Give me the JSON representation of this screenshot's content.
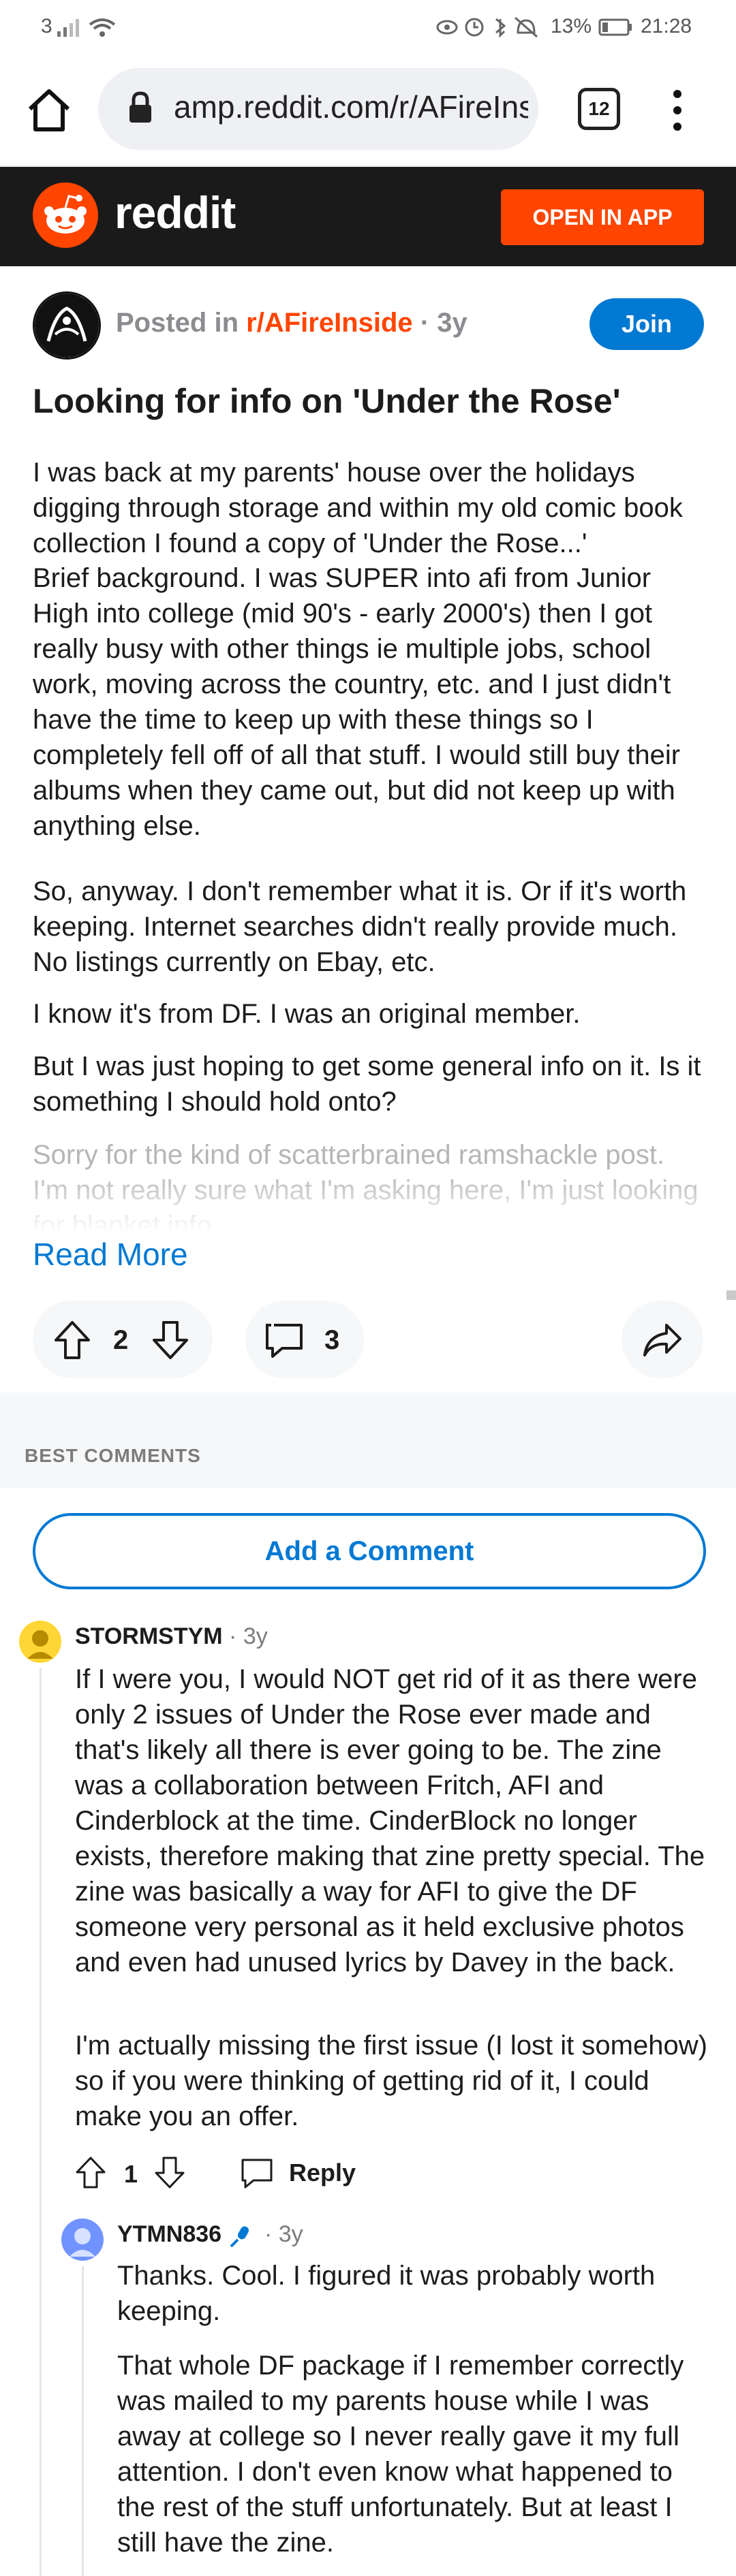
{
  "status_bar": {
    "signal_text": "3",
    "battery": "13%",
    "time": "21:28"
  },
  "browser": {
    "url": "amp.reddit.com/r/AFireInside",
    "tab_count": "12"
  },
  "reddit_header": {
    "logo_text": "reddit",
    "open_in_app": "OPEN IN APP"
  },
  "post": {
    "posted_in_prefix": "Posted in ",
    "subreddit": "r/AFireInside",
    "age": " · 3y",
    "join_label": "Join",
    "title": "Looking for info on 'Under the Rose'",
    "paragraphs": [
      "I was back at my parents' house over the holidays digging through storage and within my old comic book collection I found a copy of 'Under the Rose...'",
      "Brief background. I was SUPER into afi from Junior High into college (mid 90's - early 2000's) then I got really busy with other things ie multiple jobs, school work, moving across the country, etc. and I just didn't have the time to keep up with these things so I completely fell off of all that stuff. I would still buy their albums when they came out, but did not keep up with anything else.",
      "So, anyway. I don't remember what it is. Or if it's worth keeping. Internet searches didn't really provide much. No listings currently on Ebay, etc.",
      "I know it's from DF. I was an original member.",
      "But I was just hoping to get some general info on it. Is it something I should hold onto?"
    ],
    "faded_text": "Sorry for the kind of scatterbrained ramshackle post. I'm not really sure what I'm asking here, I'm just looking for blanket info.",
    "read_more": "Read More",
    "vote_count": "2",
    "comment_count": "3"
  },
  "comments_section": {
    "header": "BEST COMMENTS",
    "add_comment": "Add a Comment"
  },
  "comments": [
    {
      "username": "STORMSTYM",
      "age": " · 3y",
      "paragraphs": [
        "If I were you, I would NOT get rid of it as there were only 2 issues of Under the Rose ever made and that's likely all there is ever going to be. The zine was a collaboration between Fritch, AFI and Cinderblock at the time. CinderBlock no longer exists, therefore making that zine pretty special. The zine was basically a way for AFI to give the DF someone very personal as it held exclusive photos and even had unused lyrics by Davey in the back.",
        "I'm actually missing the first issue (I lost it somehow) so if you were thinking of getting rid of it, I could make you an offer."
      ],
      "vote_count": "1",
      "reply_label": "Reply"
    },
    {
      "username": "YTMN836",
      "age": " · 3y",
      "paragraphs": [
        "Thanks. Cool. I figured it was probably worth keeping.",
        "That whole DF package if I remember correctly was mailed to my parents house while I was away at college so I never really gave it my full attention. I don't even know what happened to the rest of the stuff unfortunately. But at least I still have the zine."
      ]
    }
  ],
  "colors": {
    "reddit_orange": "#ff4500",
    "reddit_blue": "#0079d3",
    "header_dark": "#1a1a1b"
  }
}
